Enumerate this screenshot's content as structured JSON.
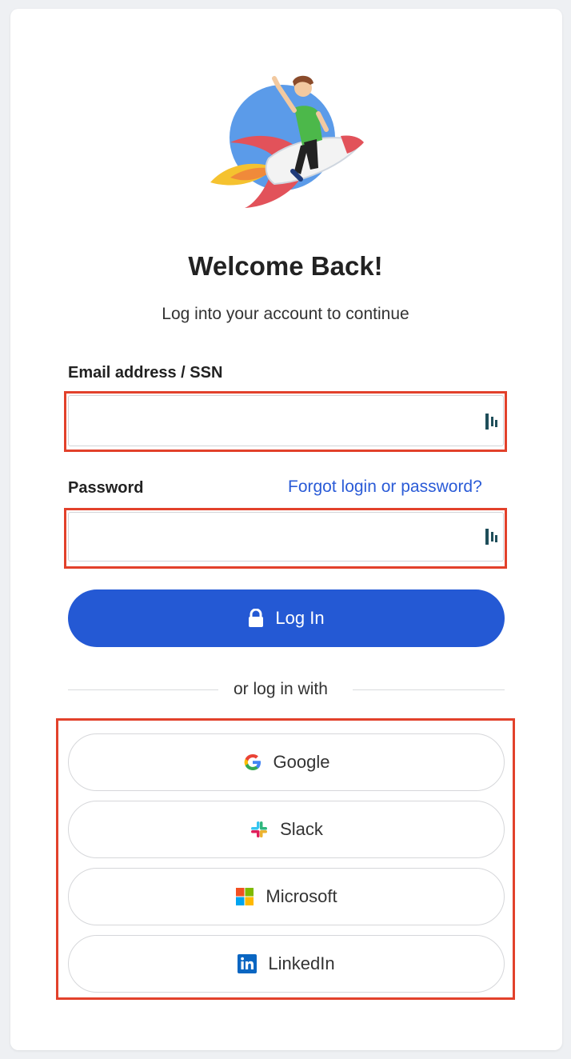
{
  "header": {
    "title": "Welcome Back!",
    "subtitle": "Log into your account to continue"
  },
  "form": {
    "email_label": "Email address / SSN",
    "email_value": "",
    "password_label": "Password",
    "password_value": "",
    "forgot_link": "Forgot login or password?",
    "field_icon": "dashlane-icon"
  },
  "login_button": {
    "label": "Log In",
    "icon": "lock-icon"
  },
  "divider": {
    "text": "or log in with"
  },
  "social": [
    {
      "label": "Google",
      "icon": "google-icon"
    },
    {
      "label": "Slack",
      "icon": "slack-icon"
    },
    {
      "label": "Microsoft",
      "icon": "microsoft-icon"
    },
    {
      "label": "LinkedIn",
      "icon": "linkedin-icon"
    }
  ],
  "colors": {
    "primary": "#2459d4",
    "link": "#2a5bd7",
    "highlight": "#e2412b",
    "background": "#eef0f3"
  }
}
